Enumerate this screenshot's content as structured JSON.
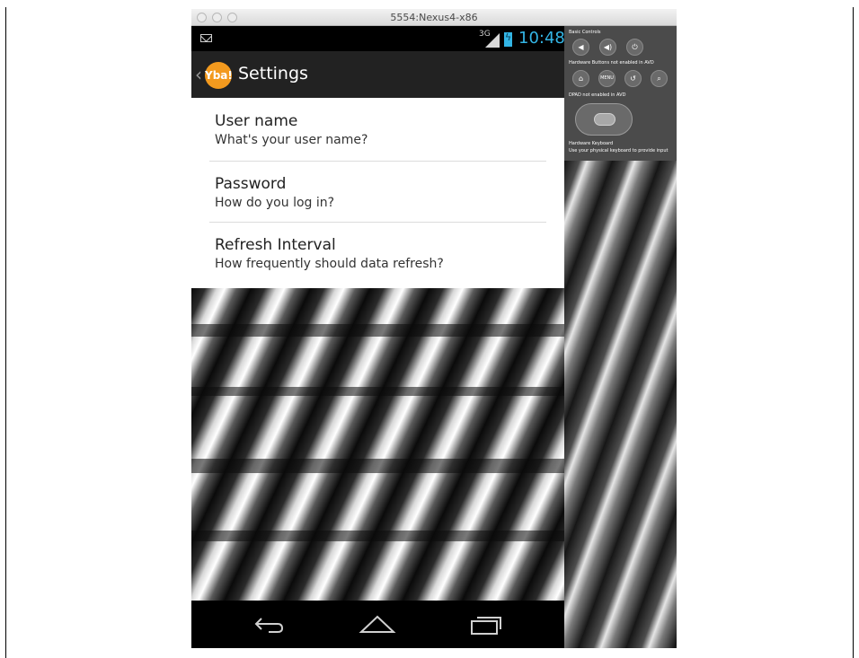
{
  "window": {
    "title": "5554:Nexus4-x86"
  },
  "status_bar": {
    "network": "3G",
    "time": "10:48",
    "notification_icon": "mail-icon",
    "accent": "#33b5e5"
  },
  "action_bar": {
    "back_glyph": "‹",
    "logo_text": "Yba!",
    "title": "Settings",
    "logo_color": "#f39a1e"
  },
  "preferences": [
    {
      "title": "User name",
      "summary": "What's your user name?"
    },
    {
      "title": "Password",
      "summary": "How do you log in?"
    },
    {
      "title": "Refresh Interval",
      "summary": "How frequently should data refresh?"
    }
  ],
  "nav_bar": {
    "back_icon": "back-arrow-icon",
    "home_icon": "home-icon",
    "recents_icon": "recent-apps-icon"
  },
  "emulator_controls": {
    "basic_controls_label": "Basic Controls",
    "hardware_buttons_label": "Hardware Buttons not enabled in AVD",
    "menu_label": "MENU",
    "dpad_label": "DPAD not enabled in AVD",
    "keyboard_label": "Hardware Keyboard",
    "keyboard_hint": "Use your physical keyboard to provide input"
  }
}
